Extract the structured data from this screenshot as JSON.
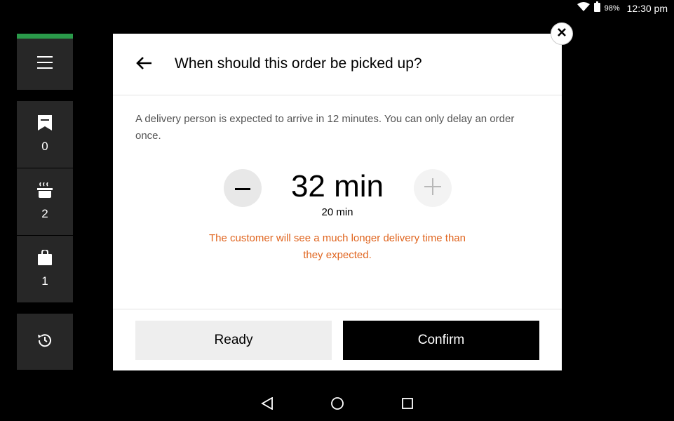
{
  "status_bar": {
    "battery_percent": "98%",
    "time": "12:30 pm",
    "icons": [
      "wifi-icon",
      "battery-icon"
    ]
  },
  "sidebar": {
    "accent_color": "#2a9a4a",
    "items": [
      {
        "icon": "receipt-icon",
        "count": "0"
      },
      {
        "icon": "cooking-pot-icon",
        "count": "2"
      },
      {
        "icon": "bag-icon",
        "count": "1"
      }
    ],
    "menu_icon": "hamburger-menu-icon",
    "history_icon": "history-icon"
  },
  "modal": {
    "title": "When should this order be picked up?",
    "description": "A delivery person is expected to arrive in 12 minutes. You can only delay an order once.",
    "delay_value": "32 min",
    "current_time": "20 min",
    "warning": "The customer will see a much longer delivery time than they expected.",
    "warning_color": "#e0651f",
    "ready_label": "Ready",
    "confirm_label": "Confirm"
  },
  "nav": {
    "icons": [
      "back-triangle-icon",
      "home-circle-icon",
      "recents-square-icon"
    ]
  }
}
